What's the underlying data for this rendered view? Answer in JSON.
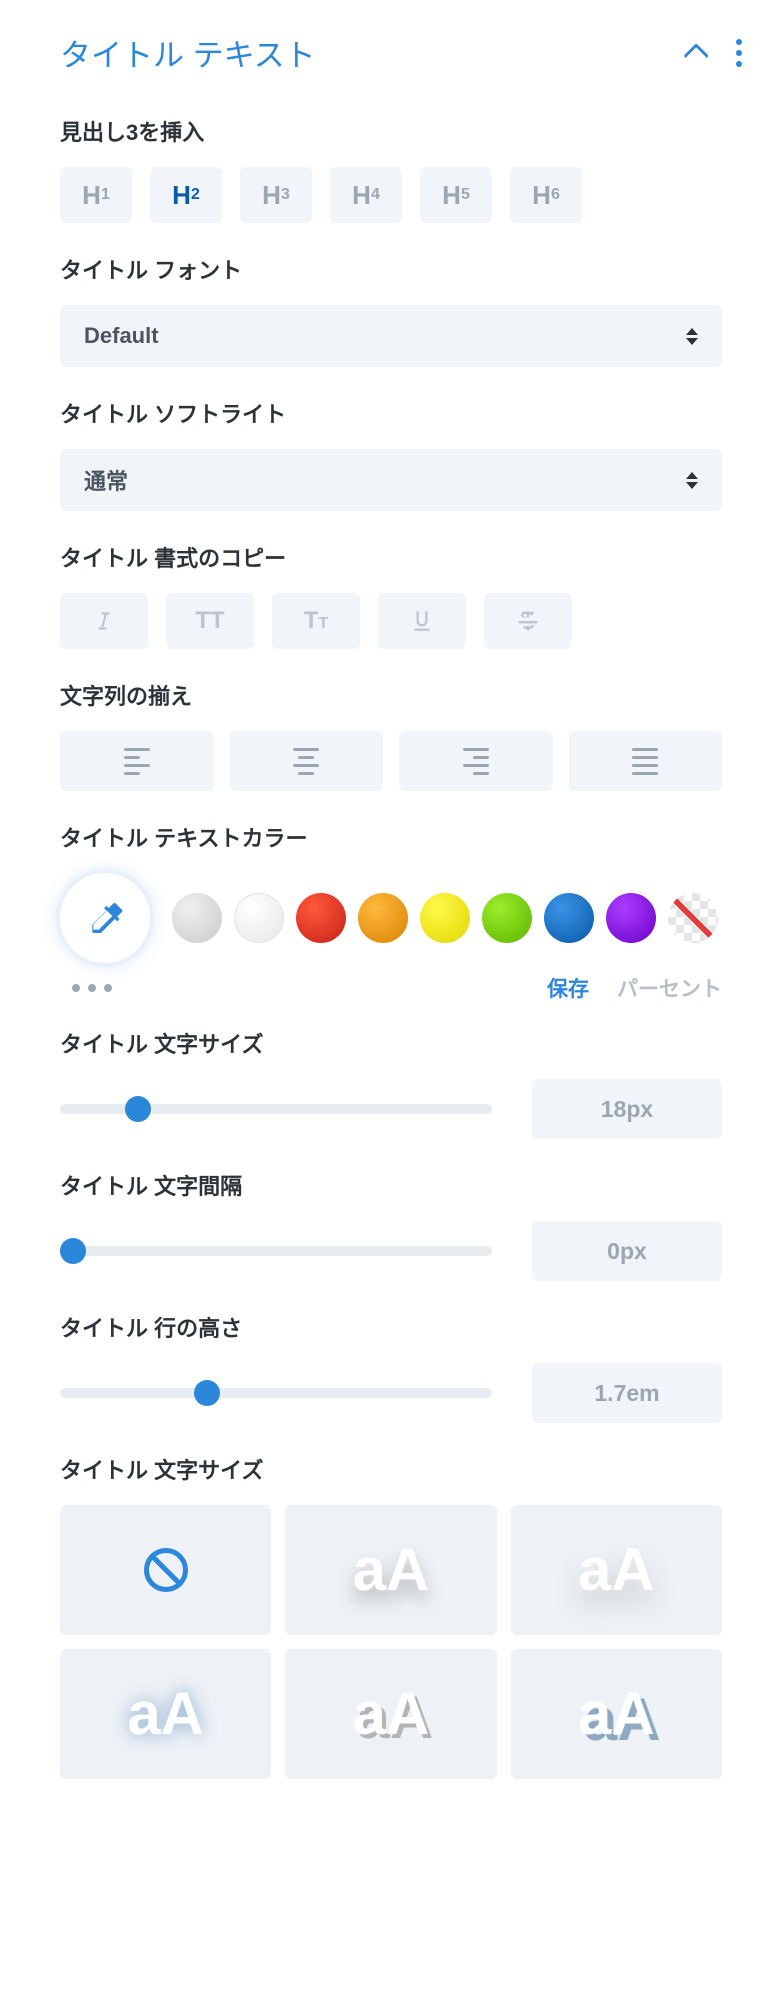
{
  "header": {
    "title": "タイトル テキスト"
  },
  "heading": {
    "label": "見出し3を挿入",
    "items": [
      {
        "main": "H",
        "sub": "1"
      },
      {
        "main": "H",
        "sub": "2"
      },
      {
        "main": "H",
        "sub": "3"
      },
      {
        "main": "H",
        "sub": "4"
      },
      {
        "main": "H",
        "sub": "5"
      },
      {
        "main": "H",
        "sub": "6"
      }
    ],
    "active_index": 1
  },
  "font": {
    "label": "タイトル フォント",
    "value": "Default"
  },
  "softlight": {
    "label": "タイトル ソフトライト",
    "value": "通常"
  },
  "format": {
    "label": "タイトル 書式のコピー"
  },
  "align": {
    "label": "文字列の揃え"
  },
  "color": {
    "label": "タイトル テキストカラー",
    "swatches": [
      "#d7d7d7",
      "#ffffff",
      "#e02b20",
      "#edb059",
      "#f4e500",
      "#7cdb00",
      "#0c71c3",
      "#8300e9"
    ],
    "save": "保存",
    "percent": "パーセント"
  },
  "text_size": {
    "label": "タイトル 文字サイズ",
    "value": "18px",
    "percent": 18
  },
  "letter_spacing": {
    "label": "タイトル 文字間隔",
    "value": "0px",
    "percent": 0
  },
  "line_height": {
    "label": "タイトル 行の高さ",
    "value": "1.7em",
    "percent": 34
  },
  "text_shadow": {
    "label": "タイトル 文字サイズ",
    "tiles": [
      "none",
      "aA",
      "aA",
      "aA",
      "aA",
      "aA"
    ]
  }
}
